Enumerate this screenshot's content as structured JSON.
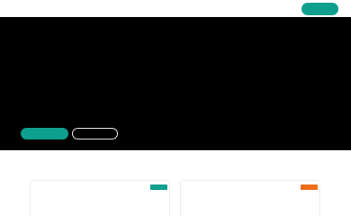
{
  "header": {
    "nav": [
      "",
      "",
      "",
      ""
    ],
    "cta_label": ""
  },
  "hero": {
    "primary_label": "",
    "secondary_label": ""
  },
  "cards": [
    {
      "badge": "",
      "badge_color": "#0e9f8e"
    },
    {
      "badge": "",
      "badge_color": "#ef6c1a"
    }
  ],
  "colors": {
    "accent": "#0e9f8e",
    "hero_bg": "#000000",
    "orange": "#ef6c1a"
  }
}
